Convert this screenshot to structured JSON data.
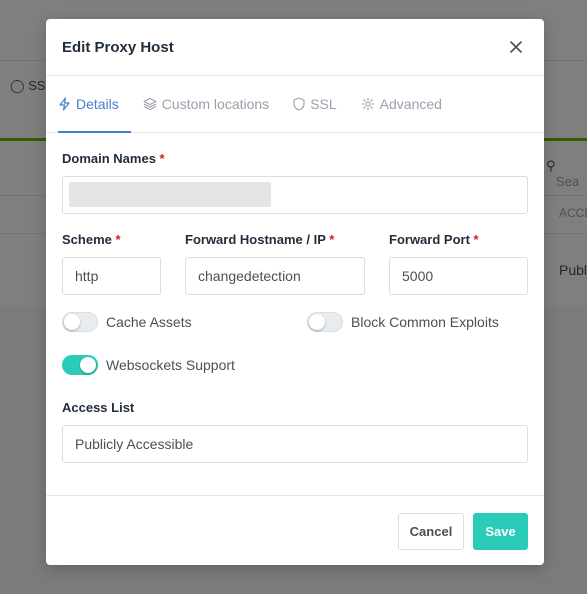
{
  "background": {
    "ssl_label": "SSL",
    "search_placeholder": "Sea",
    "column_header": "ACCE",
    "cell_value": "Publ"
  },
  "modal": {
    "title": "Edit Proxy Host",
    "tabs": [
      {
        "label": "Details",
        "icon": "bolt-icon",
        "active": true
      },
      {
        "label": "Custom locations",
        "icon": "layers-icon",
        "active": false
      },
      {
        "label": "SSL",
        "icon": "shield-icon",
        "active": false
      },
      {
        "label": "Advanced",
        "icon": "gear-icon",
        "active": false
      }
    ],
    "domain_names": {
      "label": "Domain Names",
      "required_mark": "*"
    },
    "scheme": {
      "label": "Scheme",
      "required_mark": "*",
      "value": "http"
    },
    "forward_host": {
      "label": "Forward Hostname / IP",
      "required_mark": "*",
      "value": "changedetection"
    },
    "forward_port": {
      "label": "Forward Port",
      "required_mark": "*",
      "value": "5000"
    },
    "toggles": {
      "cache_assets": {
        "label": "Cache Assets",
        "on": false
      },
      "block_exploits": {
        "label": "Block Common Exploits",
        "on": false
      },
      "websockets": {
        "label": "Websockets Support",
        "on": true
      }
    },
    "access_list": {
      "label": "Access List",
      "value": "Publicly Accessible"
    },
    "buttons": {
      "cancel": "Cancel",
      "save": "Save"
    }
  },
  "colors": {
    "accent": "#467fcf",
    "teal": "#2bcbba",
    "required": "#cd201f"
  }
}
